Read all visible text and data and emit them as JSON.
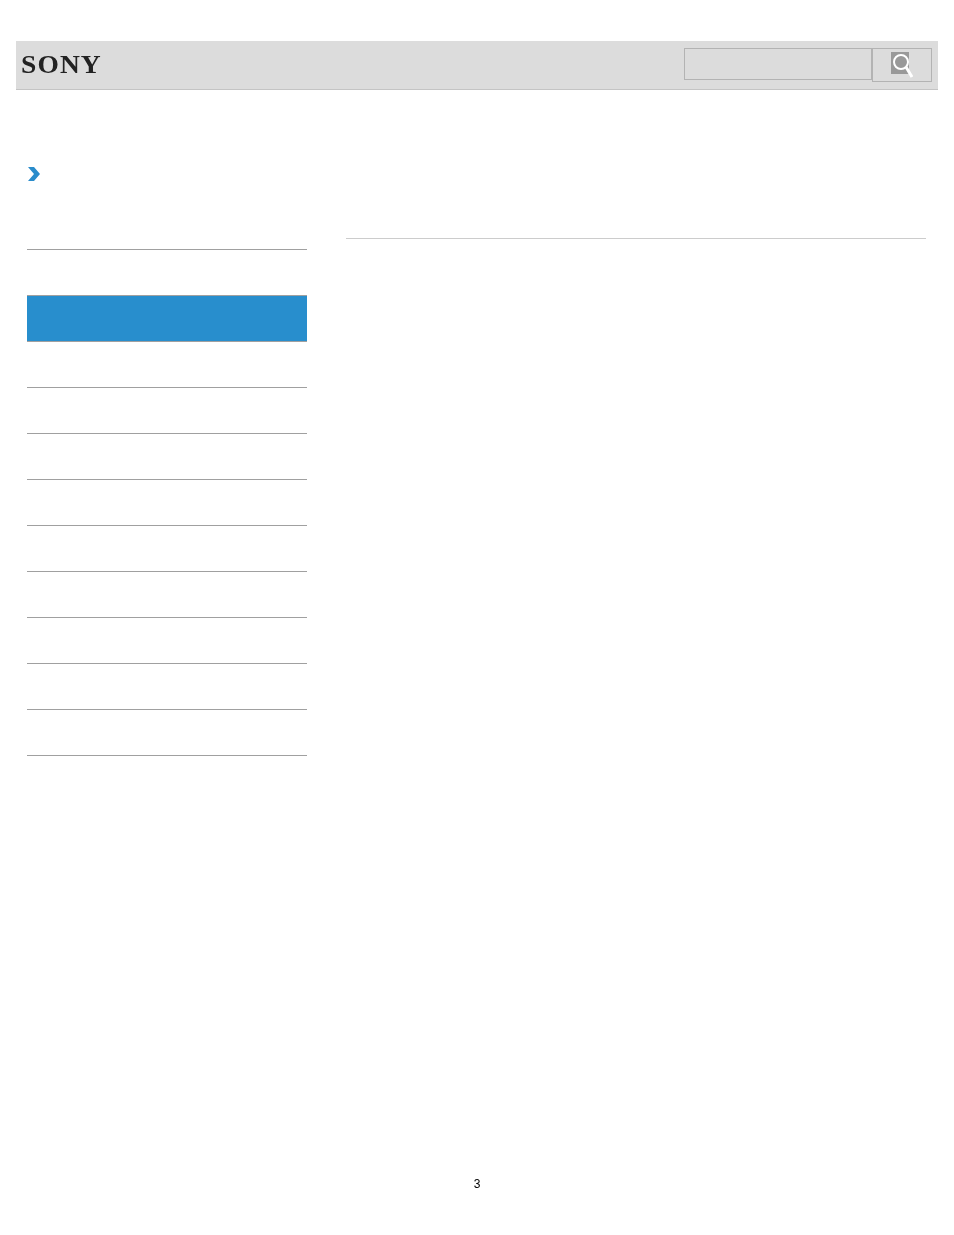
{
  "header": {
    "logo": "SONY",
    "search": {
      "button": true
    }
  },
  "sidebar": {
    "items": [
      {
        "selected": false
      },
      {
        "selected": true
      },
      {
        "selected": false
      },
      {
        "selected": false
      },
      {
        "selected": false
      },
      {
        "selected": false
      },
      {
        "selected": false
      },
      {
        "selected": false
      },
      {
        "selected": false
      },
      {
        "selected": false
      },
      {
        "selected": false
      }
    ]
  },
  "footer": {
    "page_number": "3"
  }
}
